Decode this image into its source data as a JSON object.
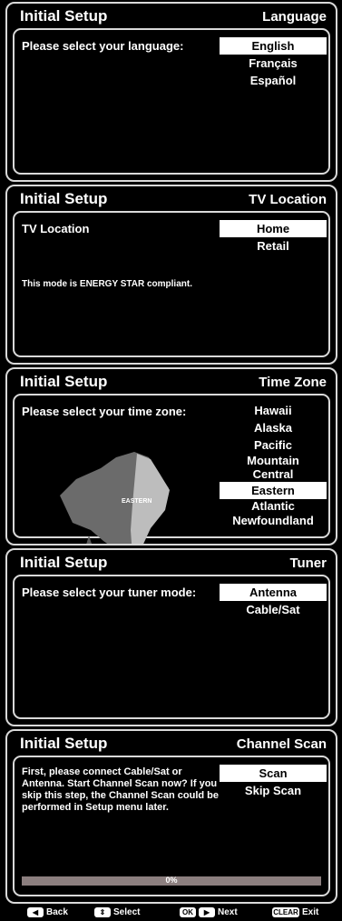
{
  "screens": [
    {
      "title": "Initial Setup",
      "right": "Language",
      "prompt": "Please select your language:",
      "options": [
        "English",
        "Français",
        "Español"
      ],
      "selected_index": 0
    },
    {
      "title": "Initial Setup",
      "right": "TV Location",
      "prompt": "TV Location",
      "options": [
        "Home",
        "Retail"
      ],
      "selected_index": 0,
      "note": "This mode is ENERGY STAR compliant."
    },
    {
      "title": "Initial Setup",
      "right": "Time Zone",
      "prompt": "Please select your time zone:",
      "options": [
        "Hawaii",
        "Alaska",
        "Pacific",
        "Mountain",
        "Central",
        "Eastern",
        "Atlantic",
        "Newfoundland"
      ],
      "selected_index": 5,
      "map_label": "EASTERN"
    },
    {
      "title": "Initial Setup",
      "right": "Tuner",
      "prompt": "Please select your tuner mode:",
      "options": [
        "Antenna",
        "Cable/Sat"
      ],
      "selected_index": 0
    },
    {
      "title": "Initial Setup",
      "right": "Channel Scan",
      "prompt": "First, please connect Cable/Sat or Antenna. Start Channel Scan now? If you skip this step, the Channel Scan could be performed in Setup menu later.",
      "options": [
        "Scan",
        "Skip Scan"
      ],
      "selected_index": 0,
      "progress_value": 0,
      "progress_text": "0%"
    }
  ],
  "footer": {
    "back": "Back",
    "select": "Select",
    "ok_key": "OK",
    "next": "Next",
    "clear_key": "CLEAR",
    "exit": "Exit"
  }
}
